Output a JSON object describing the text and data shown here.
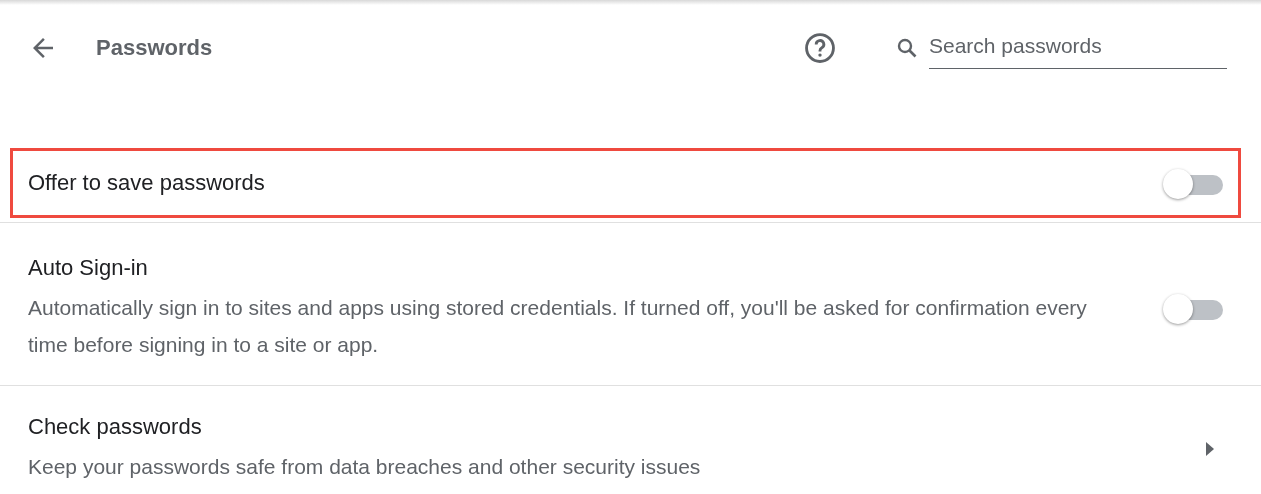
{
  "header": {
    "title": "Passwords",
    "search": {
      "placeholder": "Search passwords"
    }
  },
  "settings": [
    {
      "kind": "toggle",
      "label": "Offer to save passwords",
      "on": false,
      "highlighted": true
    },
    {
      "kind": "toggle",
      "label": "Auto Sign-in",
      "description": "Automatically sign in to sites and apps using stored credentials. If turned off, you'll be asked for confirmation every time before signing in to a site or app.",
      "on": false,
      "highlighted": false
    },
    {
      "kind": "link",
      "label": "Check passwords",
      "description": "Keep your passwords safe from data breaches and other security issues",
      "highlighted": false
    }
  ]
}
